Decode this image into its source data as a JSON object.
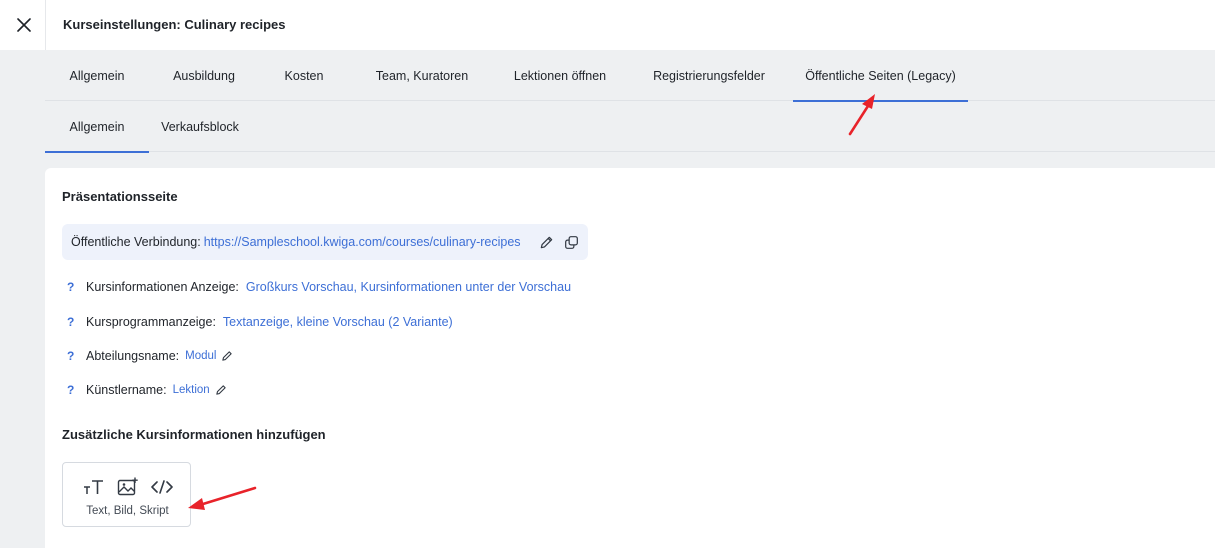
{
  "window": {
    "title": "Kurseinstellungen: Culinary recipes",
    "close_icon": "close-icon"
  },
  "tabs_primary": [
    {
      "label": "Allgemein",
      "active": false
    },
    {
      "label": "Ausbildung",
      "active": false
    },
    {
      "label": "Kosten",
      "active": false
    },
    {
      "label": "Team, Kuratoren",
      "active": false
    },
    {
      "label": "Lektionen öffnen",
      "active": false
    },
    {
      "label": "Registrierungsfelder",
      "active": false
    },
    {
      "label": "Öffentliche Seiten (Legacy)",
      "active": true
    }
  ],
  "tabs_secondary": [
    {
      "label": "Allgemein",
      "active": true
    },
    {
      "label": "Verkaufsblock",
      "active": false
    }
  ],
  "presentation": {
    "title": "Präsentationsseite",
    "link_label": "Öffentliche Verbindung:",
    "link_url": "https://Sampleschool.kwiga.com/courses/culinary-recipes",
    "edit_icon": "pencil-icon",
    "copy_icon": "copy-icon"
  },
  "info_rows": [
    {
      "label": "Kursinformationen Anzeige:",
      "value": "Großkurs Vorschau, Kursinformationen unter der Vorschau"
    },
    {
      "label": "Kursprogrammanzeige:",
      "value": "Textanzeige, kleine Vorschau (2 Variante)"
    },
    {
      "label": "Abteilungsname:",
      "value": "Modul"
    },
    {
      "label": "Künstlername:",
      "value": "Lektion"
    }
  ],
  "help_mark": "?",
  "additional": {
    "title": "Zusätzliche Kursinformationen hinzufügen",
    "block_label": "Text, Bild, Skript",
    "icons": [
      "text-size-icon",
      "image-add-icon",
      "code-icon"
    ]
  },
  "colors": {
    "accent": "#3d6fd6",
    "annotation": "#e8232a",
    "link_box_bg": "#eef2fb",
    "page_bg": "#eef0f2"
  }
}
